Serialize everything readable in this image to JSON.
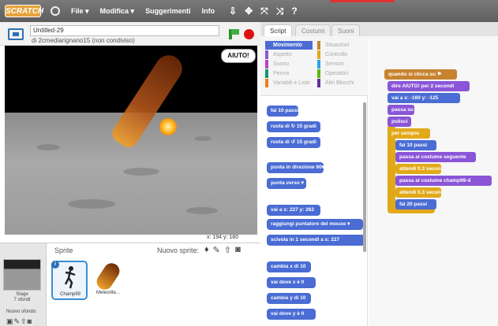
{
  "menubar": {
    "logo": "SCRATCH",
    "items": [
      "File ▾",
      "Modifica ▾",
      "Suggerimenti",
      "Info"
    ],
    "tools": [
      "⇩",
      "✥",
      "⤧",
      "⤨",
      "?"
    ]
  },
  "project": {
    "title": "Untitled-29",
    "subtitle": "di 2cmediarignano15 (non condiviso)"
  },
  "stage": {
    "bubble": "AIUTO!",
    "coords": "x: 194   y: 180"
  },
  "sprites": {
    "header": "Sprite",
    "new_sprite_label": "Nuovo sprite:",
    "stage_label": "Stage",
    "stage_sub": "7 sfondi",
    "new_bg_label": "Nuovo sfondo:",
    "list": [
      {
        "name": "Champ99"
      },
      {
        "name": "Meteorite..."
      }
    ]
  },
  "tabs": [
    "Script",
    "Costumi",
    "Suoni"
  ],
  "categories": {
    "left": [
      "Movimento",
      "Aspetto",
      "Suono",
      "Penna",
      "Variabili e Liste"
    ],
    "right": [
      "Situazioni",
      "Controllo",
      "Sensori",
      "Operatori",
      "Altri Blocchi"
    ],
    "colors": {
      "Movimento": "#4a6cd4",
      "Aspetto": "#8a55d7",
      "Suono": "#bb42c3",
      "Penna": "#0e9a6c",
      "Variabili e Liste": "#ee7d16",
      "Situazioni": "#c88330",
      "Controllo": "#e1a91a",
      "Sensori": "#2ca5e2",
      "Operatori": "#5cb712",
      "Altri Blocchi": "#632d99"
    }
  },
  "palette_blocks": [
    "fai  10  passi",
    "ruota di ↻  15  gradi",
    "ruota di ↺  15  gradi",
    "punta in direzione  90▾",
    "punta verso  ▾",
    "vai a x:  227  y:  262",
    "raggiungi  puntatore del mouse ▾",
    "scivola in  1  secondi a x:  227",
    "cambia x di  10",
    "vai dove x è  0",
    "cambia y di  10",
    "vai dove y è  0"
  ],
  "script_blocks": [
    {
      "text": "quando si clicca su  ⚑",
      "kind": "event"
    },
    {
      "text": "dire  AIUTO!  per  2  secondi",
      "kind": "look"
    },
    {
      "text": "vai a x:  -160  y:  -125",
      "kind": "motion"
    },
    {
      "text": "passa su",
      "kind": "look"
    },
    {
      "text": "pulisci",
      "kind": "look"
    },
    {
      "text": "per sempre",
      "kind": "control"
    },
    {
      "text": "fai  10  passi",
      "kind": "motion"
    },
    {
      "text": "passa al costume seguente",
      "kind": "look"
    },
    {
      "text": "attendi  0.3  secondi",
      "kind": "control"
    },
    {
      "text": "passa al costume  champ99-d",
      "kind": "look"
    },
    {
      "text": "attendi  0.3  secondi",
      "kind": "control"
    },
    {
      "text": "fai  20  passi",
      "kind": "motion"
    }
  ]
}
